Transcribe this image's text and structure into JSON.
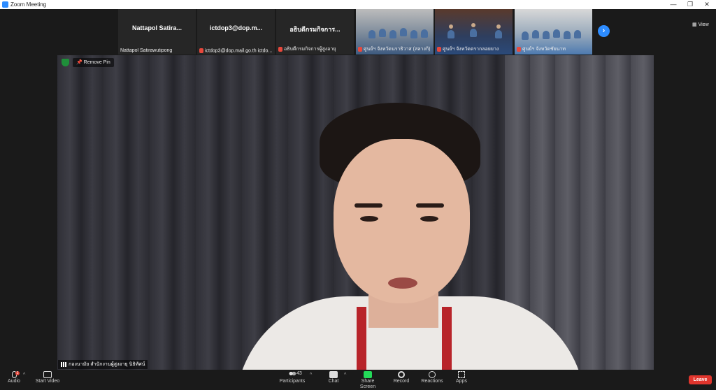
{
  "window": {
    "title": "Zoom Meeting",
    "minimize_glyph": "—",
    "maximize_glyph": "❐",
    "close_glyph": "✕"
  },
  "gallery": {
    "view_label": "View",
    "next_glyph": "›",
    "tiles": [
      {
        "center_name": "Nattapol Satira...",
        "label": "Nattapol Satirawutipong",
        "muted": false
      },
      {
        "center_name": "ictdop3@dop.m...",
        "label": "ictdop3@dop.mail.go.th ictdo...",
        "muted": true
      },
      {
        "center_name": "อธิบดีกรมกิจการ...",
        "label": "อธิบดีกรมกิจการผู้สูงอายุ",
        "muted": true
      },
      {
        "center_name": "",
        "label": "ศูนย์ฯ จังหวัดนราธิวาส (สลางกิ)",
        "muted": true
      },
      {
        "center_name": "",
        "label": "ศูนย์ฯ จังหวัดตรากลอยยาง",
        "muted": true
      },
      {
        "center_name": "",
        "label": "ศูนย์ฯ จังหวัดชัยนาท",
        "muted": true
      }
    ]
  },
  "main_video": {
    "remove_pin_label": "Remove Pin",
    "speaker_label": "กองนามัย สำนักงานผู้สูงอายุ นิธิทัศน์"
  },
  "toolbar": {
    "audio_label": "Audio",
    "start_video_label": "Start Video",
    "participants_label": "Participants",
    "participants_count": "43",
    "chat_label": "Chat",
    "share_screen_label": "Share Screen",
    "record_label": "Record",
    "reactions_label": "Reactions",
    "apps_label": "Apps",
    "leave_label": "Leave",
    "audio_badge": "1"
  },
  "colors": {
    "accent": "#2d8cff",
    "leave": "#e0352d",
    "share": "#23d959",
    "muted": "#e8483c"
  }
}
